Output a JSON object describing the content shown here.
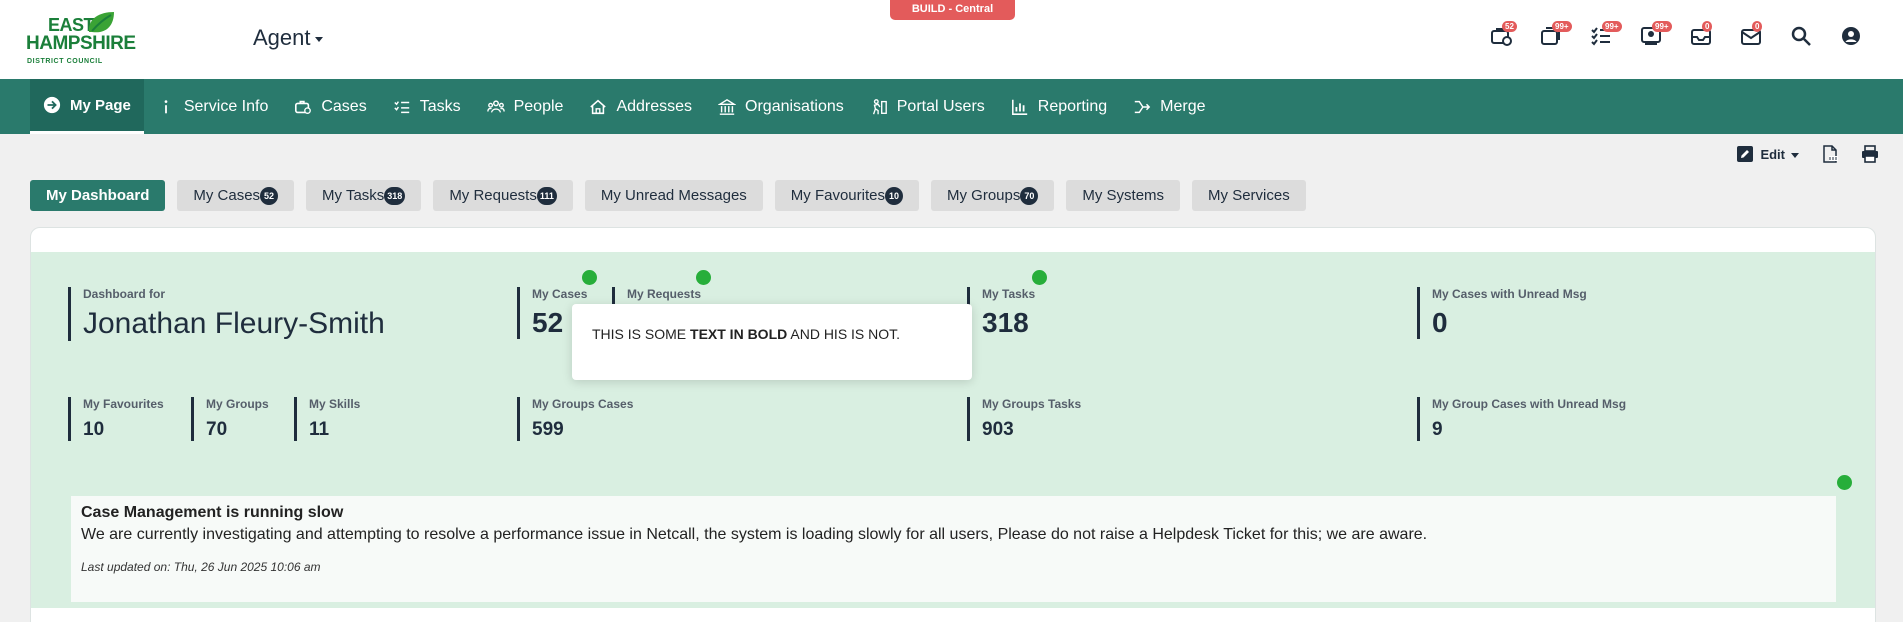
{
  "header": {
    "logo_line1": "EAST",
    "logo_line2": "HAMPSHIRE",
    "logo_line3": "DISTRICT COUNCIL",
    "role": "Agent",
    "build": "BUILD - Central",
    "icons": [
      {
        "name": "cases-icon",
        "badge": "52"
      },
      {
        "name": "messages-icon",
        "badge": "99+"
      },
      {
        "name": "tasks-icon",
        "badge": "99+"
      },
      {
        "name": "people-icon",
        "badge": "99+"
      },
      {
        "name": "inbox-icon",
        "badge": "0"
      },
      {
        "name": "mail-icon",
        "badge": "0"
      }
    ]
  },
  "nav": {
    "items": [
      {
        "label": "My Page",
        "icon": "arrow-circle-icon"
      },
      {
        "label": "Service Info",
        "icon": "info-icon"
      },
      {
        "label": "Cases",
        "icon": "briefcase-icon"
      },
      {
        "label": "Tasks",
        "icon": "task-list-icon"
      },
      {
        "label": "People",
        "icon": "people-icon"
      },
      {
        "label": "Addresses",
        "icon": "house-icon"
      },
      {
        "label": "Organisations",
        "icon": "building-icon"
      },
      {
        "label": "Portal Users",
        "icon": "portal-user-icon"
      },
      {
        "label": "Reporting",
        "icon": "chart-icon"
      },
      {
        "label": "Merge",
        "icon": "merge-icon"
      }
    ]
  },
  "toolbar": {
    "edit": "Edit"
  },
  "tabs": [
    {
      "label": "My Dashboard",
      "badge": ""
    },
    {
      "label": "My Cases",
      "badge": "52"
    },
    {
      "label": "My Tasks",
      "badge": "318"
    },
    {
      "label": "My Requests",
      "badge": "111"
    },
    {
      "label": "My Unread Messages",
      "badge": ""
    },
    {
      "label": "My Favourites",
      "badge": "10"
    },
    {
      "label": "My Groups",
      "badge": "70"
    },
    {
      "label": "My Systems",
      "badge": ""
    },
    {
      "label": "My Services",
      "badge": ""
    }
  ],
  "dashboard": {
    "for_label": "Dashboard for",
    "name": "Jonathan Fleury-Smith",
    "my_cases": {
      "label": "My Cases",
      "value": "52"
    },
    "my_requests": {
      "label": "My Requests"
    },
    "my_tasks": {
      "label": "My Tasks",
      "value": "318"
    },
    "unread": {
      "label": "My Cases with Unread Msg",
      "value": "0"
    },
    "favourites": {
      "label": "My Favourites",
      "value": "10"
    },
    "groups": {
      "label": "My Groups",
      "value": "70"
    },
    "skills": {
      "label": "My Skills",
      "value": "11"
    },
    "groups_cases": {
      "label": "My Groups Cases",
      "value": "599"
    },
    "groups_tasks": {
      "label": "My Groups Tasks",
      "value": "903"
    },
    "group_unread": {
      "label": "My Group Cases with Unread Msg",
      "value": "9"
    }
  },
  "popup": {
    "before": "THIS IS SOME ",
    "bold": "TEXT IN BOLD",
    "after": " AND HIS IS NOT."
  },
  "notice": {
    "title": "Case Management is running slow",
    "body": "We are currently investigating and attempting to resolve a performance issue in Netcall, the system is loading slowly for all users, Please do not raise a Helpdesk Ticket for this; we are aware.",
    "updated": "Last updated on: Thu, 26 Jun 2025 10:06 am"
  },
  "colors": {
    "nav": "#2a7a6c",
    "panel": "#d9efe1",
    "build": "#e35b5b",
    "dot": "#27ae3a"
  }
}
